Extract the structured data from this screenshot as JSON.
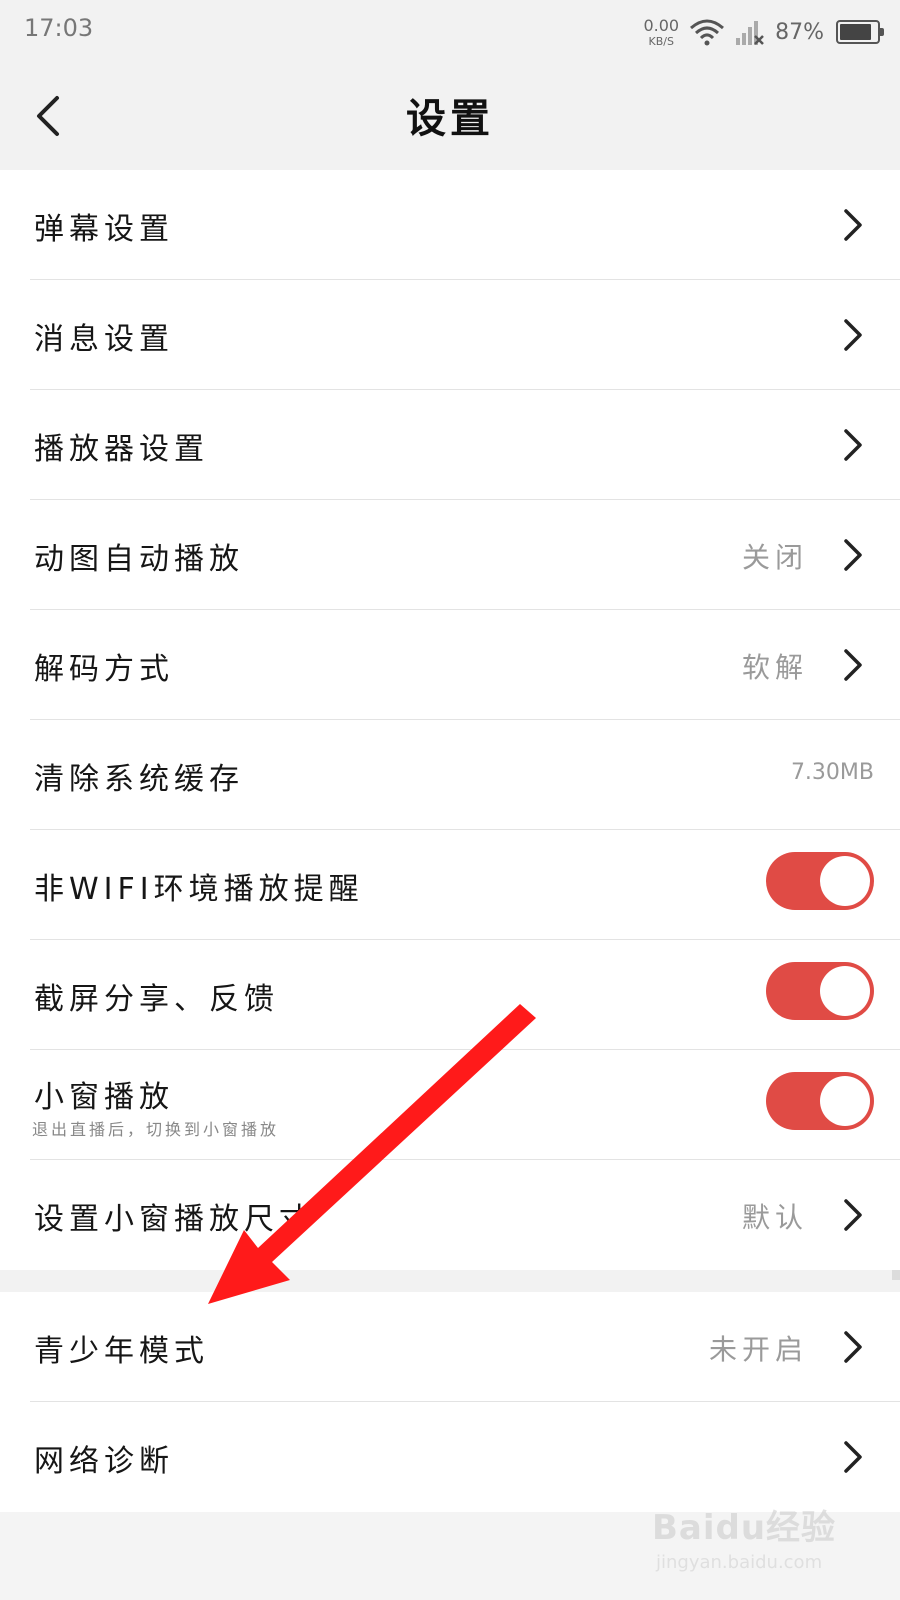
{
  "status_bar": {
    "time": "17:03",
    "net_speed": "0.00",
    "net_unit": "KB/S",
    "battery": "87%",
    "battery_level": 0.87
  },
  "header": {
    "title": "设置"
  },
  "settings": {
    "danmu": {
      "label": "弹幕设置"
    },
    "message": {
      "label": "消息设置"
    },
    "player": {
      "label": "播放器设置"
    },
    "gif_autoplay": {
      "label": "动图自动播放",
      "value": "关闭"
    },
    "decode": {
      "label": "解码方式",
      "value": "软解"
    },
    "cache": {
      "label": "清除系统缓存",
      "value": "7.30MB"
    },
    "non_wifi": {
      "label": "非WIFI环境播放提醒",
      "enabled": true
    },
    "screenshot_share": {
      "label": "截屏分享、反馈",
      "enabled": true
    },
    "mini_window": {
      "label": "小窗播放",
      "sub": "退出直播后，切换到小窗播放",
      "enabled": true
    },
    "mini_size": {
      "label": "设置小窗播放尺寸",
      "value": "默认"
    },
    "teen_mode": {
      "label": "青少年模式",
      "value": "未开启"
    },
    "network": {
      "label": "网络诊断"
    }
  },
  "watermark": {
    "brand": "Baidu经验",
    "url": "jingyan.baidu.com"
  },
  "colors": {
    "accent": "#e04b45",
    "annotation_arrow": "#ff1a1a"
  }
}
